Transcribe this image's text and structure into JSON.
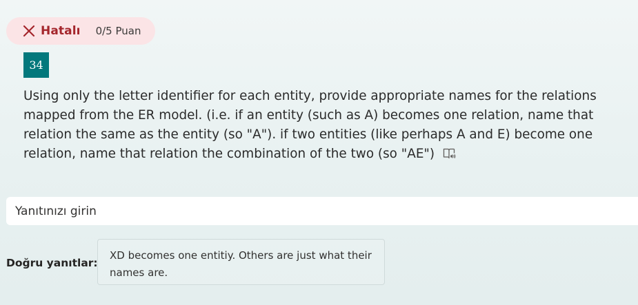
{
  "result": {
    "status_label": "Hatalı",
    "score_label": "0/5 Puan",
    "status_icon": "close-icon",
    "status_color": "#a4262c",
    "pill_background": "#fbe4e6"
  },
  "question": {
    "number": "34",
    "number_background": "#03787c",
    "text": "Using only the letter identifier for each entity, provide appropriate names for the relations mapped from the ER model. (i.e. if an entity (such as A) becomes one relation, name that relation the same as the entity (so \"A\"). if two entities (like perhaps A and E) become one relation, name that relation the combination of the two (so \"AE\")",
    "reader_icon": "immersive-reader-icon"
  },
  "answer": {
    "placeholder": "Yanıtınızı girin",
    "value": ""
  },
  "correct_answers": {
    "label": "Doğru yanıtlar:",
    "text": "XD becomes one entitiy. Others are just what their names are."
  }
}
